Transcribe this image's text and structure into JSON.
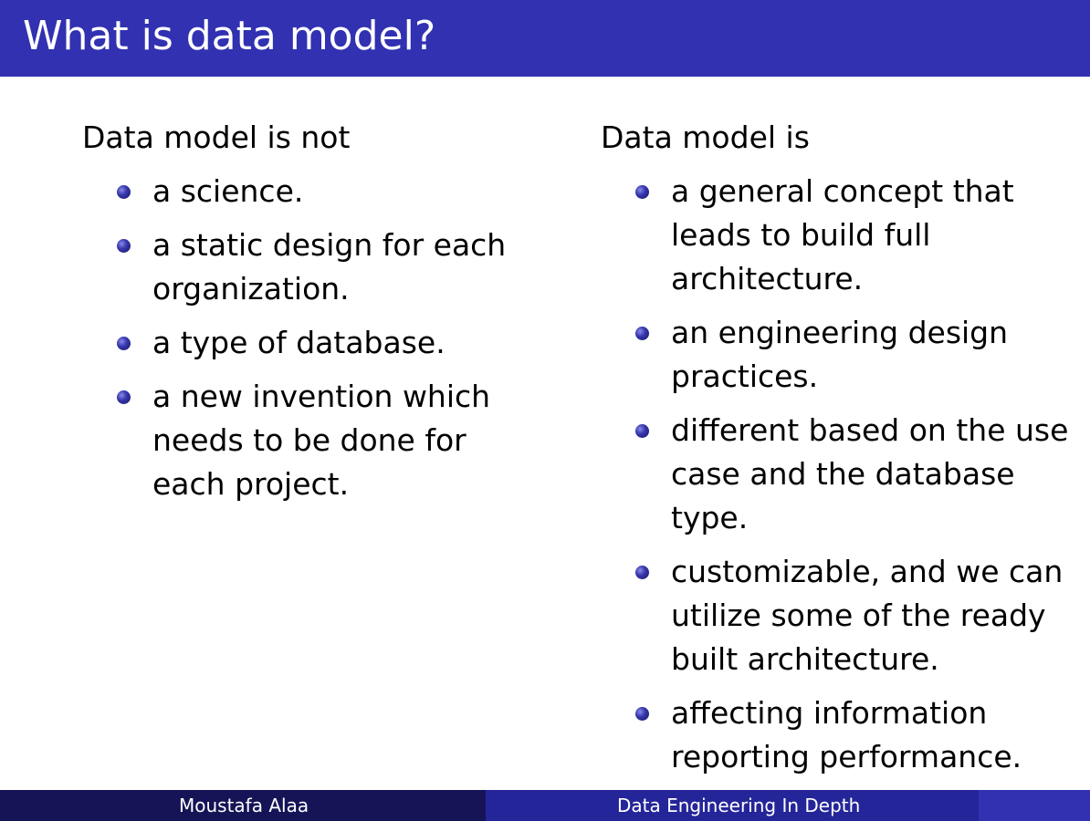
{
  "slide": {
    "title": "What is data model?"
  },
  "left_column": {
    "heading": "Data model is not",
    "items": [
      "a science.",
      "a static design for each organization.",
      "a type of database.",
      "a new invention which needs to be done for each project."
    ]
  },
  "right_column": {
    "heading": "Data model is",
    "items": [
      "a general concept that leads to build full architecture.",
      "an engineering design practices.",
      "different based on the use case and the database type.",
      "customizable, and we can utilize some of the ready built architecture.",
      "affecting information reporting performance."
    ]
  },
  "footer": {
    "author": "Moustafa Alaa",
    "course": "Data Engineering In Depth"
  },
  "colors": {
    "title_bar": "#3131b2",
    "footer_left": "#141456",
    "footer_right": "#25259a",
    "bullet": "#2a2a9a"
  }
}
